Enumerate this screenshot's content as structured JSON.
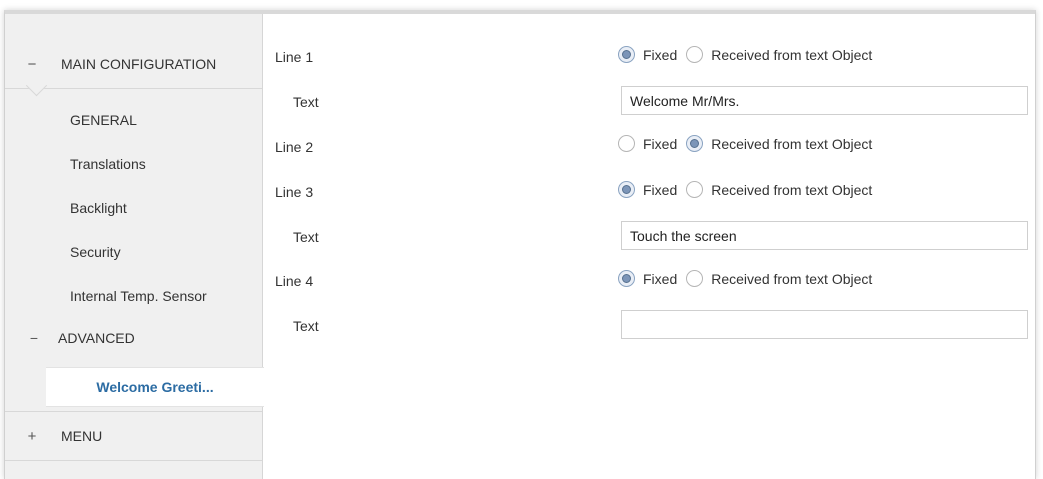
{
  "sidebar": {
    "main_configuration": {
      "toggle": "−",
      "label": "MAIN CONFIGURATION"
    },
    "items": [
      {
        "label": "GENERAL"
      },
      {
        "label": "Translations"
      },
      {
        "label": "Backlight"
      },
      {
        "label": "Security"
      },
      {
        "label": "Internal Temp. Sensor"
      }
    ],
    "advanced": {
      "toggle": "−",
      "label": "ADVANCED"
    },
    "selected": {
      "label": "Welcome Greeti..."
    },
    "menu": {
      "toggle": "+",
      "label": "MENU"
    }
  },
  "form": {
    "option_fixed": "Fixed",
    "option_received": "Received from text Object",
    "text_label": "Text",
    "lines": [
      {
        "label": "Line 1",
        "selected": "fixed",
        "text": "Welcome Mr/Mrs."
      },
      {
        "label": "Line 2",
        "selected": "received"
      },
      {
        "label": "Line 3",
        "selected": "fixed",
        "text": "Touch the screen"
      },
      {
        "label": "Line 4",
        "selected": "fixed",
        "text": ""
      }
    ]
  },
  "colors": {
    "accent": "#2c6ca3",
    "sidebar_bg": "#f0f0f0",
    "radio_checked": "#7c95b8"
  }
}
